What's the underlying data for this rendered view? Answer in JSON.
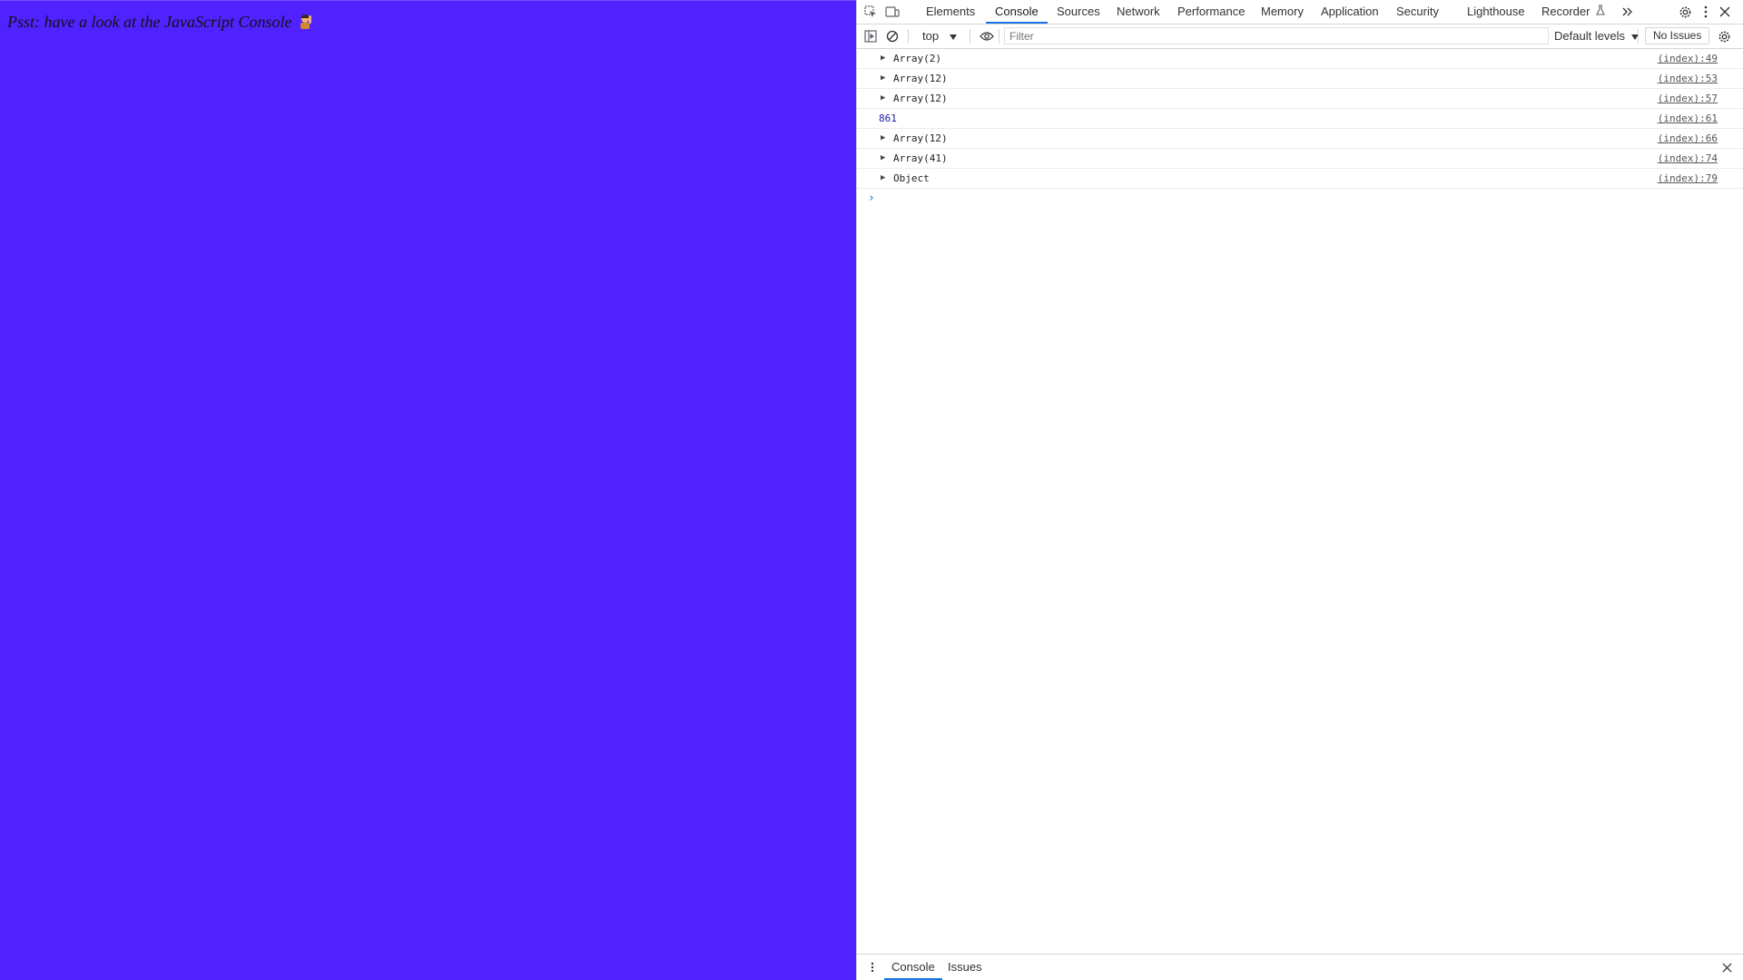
{
  "page": {
    "message": "Psst: have a look at the JavaScript Console",
    "background": "#5022ff"
  },
  "devtools": {
    "tabs": [
      "Elements",
      "Console",
      "Sources",
      "Network",
      "Performance",
      "Memory",
      "Application",
      "Security",
      "Lighthouse",
      "Recorder"
    ],
    "active_tab": "Console",
    "toolbar": {
      "context": "top",
      "filter_placeholder": "Filter",
      "levels": "Default levels",
      "issues": "No Issues"
    },
    "console_rows": [
      {
        "expandable": true,
        "text": "Array(2)",
        "source": "(index):49"
      },
      {
        "expandable": true,
        "text": "Array(12)",
        "source": "(index):53"
      },
      {
        "expandable": true,
        "text": "Array(12)",
        "source": "(index):57"
      },
      {
        "expandable": false,
        "text": "861",
        "source": "(index):61"
      },
      {
        "expandable": true,
        "text": "Array(12)",
        "source": "(index):66"
      },
      {
        "expandable": true,
        "text": "Array(41)",
        "source": "(index):74"
      },
      {
        "expandable": true,
        "text": "Object",
        "source": "(index):79"
      }
    ],
    "prompt": "›",
    "drawer": {
      "tabs": [
        "Console",
        "Issues"
      ]
    },
    "colors": {
      "accent": "#1a73e8",
      "number": "#1a1aa6"
    }
  }
}
